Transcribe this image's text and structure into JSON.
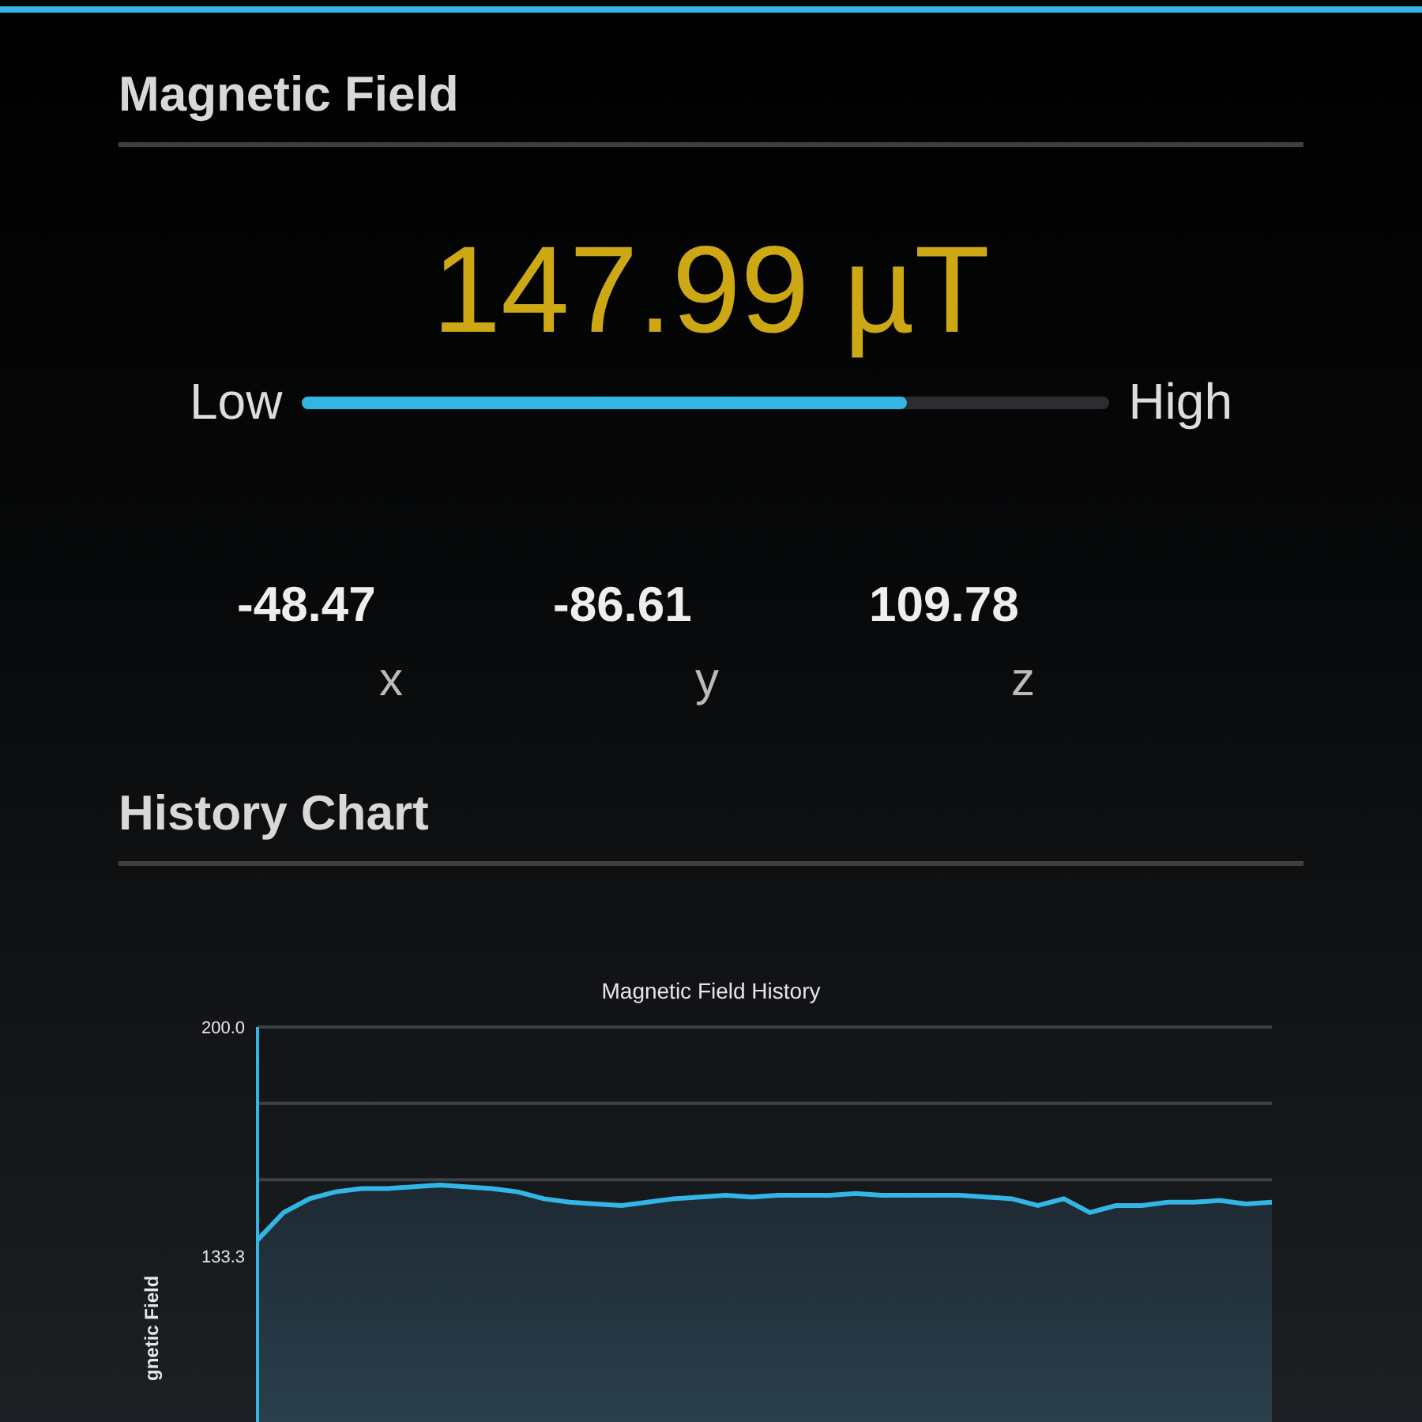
{
  "magnetic_field": {
    "heading": "Magnetic Field",
    "reading": "147.99 µT",
    "low_label": "Low",
    "high_label": "High",
    "level": 0.75,
    "axes": [
      {
        "value": "-48.47",
        "axis": "x"
      },
      {
        "value": "-86.61",
        "axis": "y"
      },
      {
        "value": "109.78",
        "axis": "z"
      }
    ]
  },
  "history": {
    "heading": "History Chart",
    "chart_data": {
      "type": "area",
      "title": "Magnetic Field History",
      "ylabel": "gnetic Field",
      "ylim": [
        85,
        200
      ],
      "yticks": [
        {
          "value": 200,
          "label": "200.0"
        },
        {
          "value": 133.3,
          "label": "133.3"
        }
      ],
      "series": [
        {
          "color": "#33b5e5",
          "values": [
            138,
            146,
            150,
            152,
            153,
            153,
            153.5,
            154,
            153.5,
            153,
            152,
            150,
            149,
            148.5,
            148,
            149,
            150,
            150.5,
            151,
            150.5,
            151,
            151,
            151,
            151.5,
            151,
            151,
            151,
            151,
            150.5,
            150,
            148,
            150,
            146,
            148,
            148,
            149,
            149,
            149.5,
            148.5,
            149
          ]
        }
      ]
    }
  }
}
